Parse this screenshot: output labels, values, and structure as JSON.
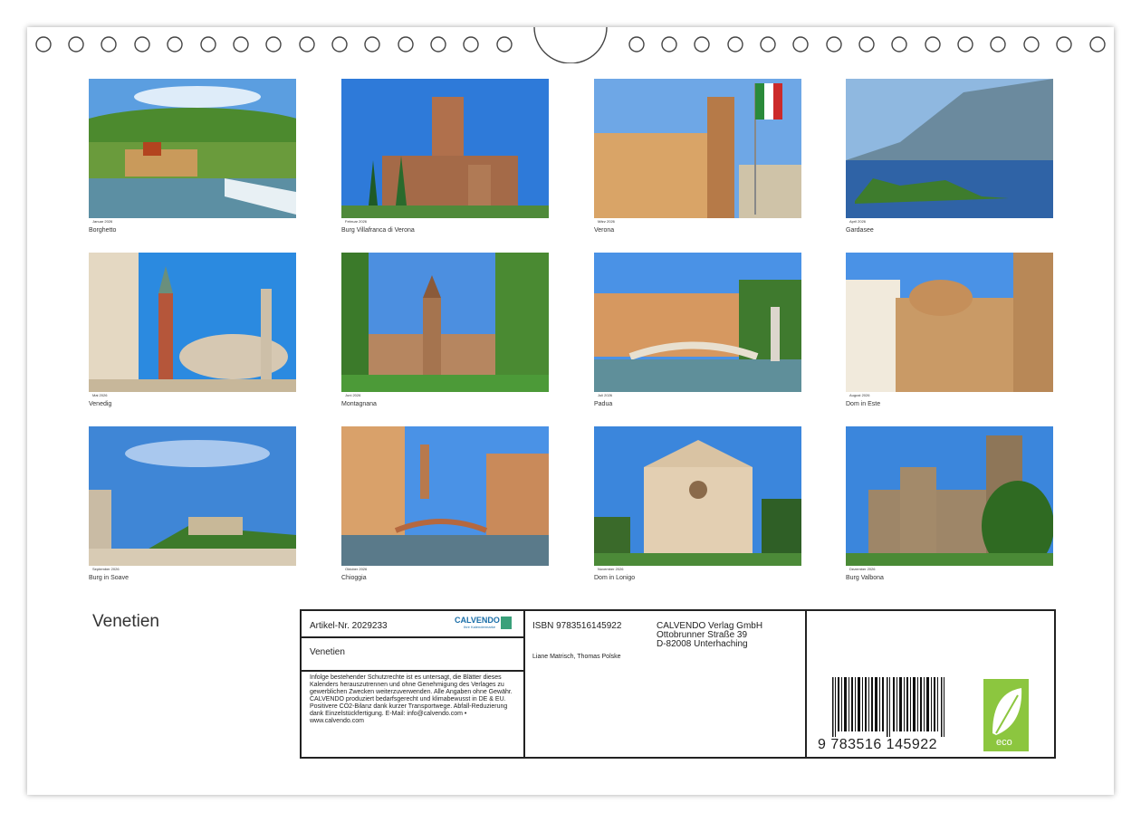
{
  "calendar": {
    "title": "Venetien",
    "photos": [
      {
        "caption": "Borghetto",
        "month": "Januar 2026"
      },
      {
        "caption": "Burg Villafranca di Verona",
        "month": "Februar 2026"
      },
      {
        "caption": "Verona",
        "month": "März 2026"
      },
      {
        "caption": "Gardasee",
        "month": "April 2026"
      },
      {
        "caption": "Venedig",
        "month": "Mai 2026"
      },
      {
        "caption": "Montagnana",
        "month": "Juni 2026"
      },
      {
        "caption": "Padua",
        "month": "Juli 2026"
      },
      {
        "caption": "Dom in Este",
        "month": "August 2026"
      },
      {
        "caption": "Burg in Soave",
        "month": "September 2026"
      },
      {
        "caption": "Chioggia",
        "month": "Oktober 2026"
      },
      {
        "caption": "Dom in Lonigo",
        "month": "November 2026"
      },
      {
        "caption": "Burg Valbona",
        "month": "Dezember 2026"
      }
    ]
  },
  "info": {
    "article": "Artikel-Nr. 2029233",
    "brand": "CALVENDO",
    "brand_sub": "Ihre Kalendermarke",
    "product_title": "Venetien",
    "legal": "Infolge bestehender Schutzrechte ist es untersagt, die Blätter dieses Kalenders herauszutrennen und ohne Genehmigung des Verlages zu gewerblichen Zwecken weiterzuverwenden. Alle Angaben ohne Gewähr. CALVENDO produziert bedarfsgerecht und klimabewusst in DE & EU. Positivere CO2-Bilanz dank kurzer Transportwege. Abfall-Reduzierung dank Einzelstückfertigung. E-Mail: info@calvendo.com • www.calvendo.com",
    "isbn": "ISBN 9783516145922",
    "publisher_line1": "CALVENDO Verlag GmbH",
    "publisher_line2": "Ottobrunner Straße 39",
    "publisher_line3": "D-82008 Unterhaching",
    "authors": "Liane Matrisch, Thomas Polske",
    "barcode_text": "9 783516 145922",
    "eco_label": "eco"
  },
  "colors": {
    "eco_green": "#8cc63f",
    "sky": "#3f86d6"
  }
}
